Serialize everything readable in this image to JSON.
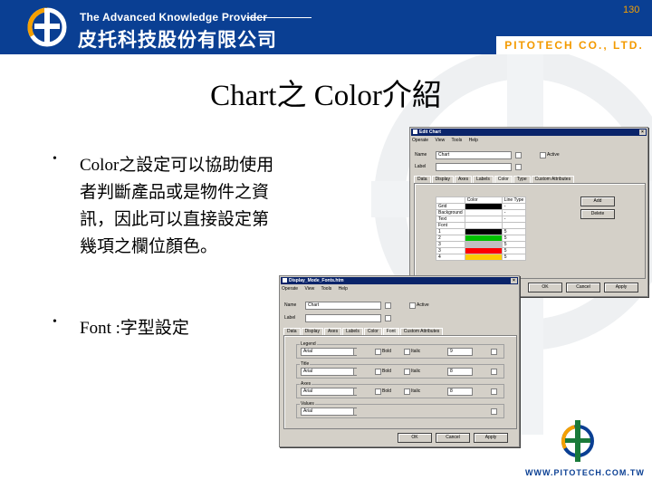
{
  "header": {
    "tagline": "The Advanced Knowledge Provider",
    "company_cn": "皮托科技股份有限公司",
    "company_en": "PITOTECH CO., LTD.",
    "page_number": "130"
  },
  "slide": {
    "title": "Chart之 Color介紹",
    "bullets": [
      "Color之設定可以協助使用者判斷產品或是物件之資訊，因此可以直接設定第幾項之欄位顏色。",
      "Font :字型設定"
    ]
  },
  "dialog_color": {
    "title": "Edit Chart",
    "menu": [
      "Operate",
      "View",
      "Tools",
      "Help"
    ],
    "name_label": "Name",
    "name_value": "Chart",
    "label_label": "Label",
    "label_value": "",
    "active_label": "Active",
    "tabs": [
      "Data",
      "Display",
      "Axes",
      "Labels",
      "Color",
      "Type",
      "Custom Attributes"
    ],
    "grid_headers": [
      "",
      "Color",
      "Line Type"
    ],
    "grid_rows": [
      {
        "label": "Grid",
        "color": "#000000",
        "line": "-"
      },
      {
        "label": "Background",
        "color": "#ffffff",
        "line": "-"
      },
      {
        "label": "Text",
        "color": "#ffffff",
        "line": "-"
      },
      {
        "label": "Font",
        "color": "#ffffff",
        "line": ""
      },
      {
        "label": "1",
        "color": "#000000",
        "line": "5"
      },
      {
        "label": "2",
        "color": "#00c000",
        "line": "5"
      },
      {
        "label": "3",
        "color": "#c0c0c0",
        "line": "5"
      },
      {
        "label": "3",
        "color": "#ff0000",
        "line": "5"
      },
      {
        "label": "4",
        "color": "#ffcc00",
        "line": "5"
      }
    ],
    "add_button": "Add",
    "delete_button": "Delete",
    "ok_button": "OK",
    "cancel_button": "Cancel",
    "apply_button": "Apply"
  },
  "dialog_font": {
    "title": "Display_Mode_Fonts.htm",
    "menu": [
      "Operate",
      "View",
      "Tools",
      "Help"
    ],
    "name_label": "Name",
    "name_value": "Chart",
    "label_label": "Label",
    "label_value": "",
    "active_label": "Active",
    "tabs": [
      "Data",
      "Display",
      "Axes",
      "Labels",
      "Color",
      "Font",
      "Custom Attributes"
    ],
    "groups": [
      {
        "label": "Legend",
        "font": "Arial",
        "bold": "Bold",
        "italic": "Italic",
        "size": "9"
      },
      {
        "label": "Title",
        "font": "Arial",
        "bold": "Bold",
        "italic": "Italic",
        "size": "8"
      },
      {
        "label": "Axes",
        "font": "Arial",
        "bold": "Bold",
        "italic": "Italic",
        "size": "8"
      },
      {
        "label": "Values",
        "font": "Arial",
        "bold": "",
        "italic": "",
        "size": ""
      }
    ],
    "ok_button": "OK",
    "cancel_button": "Cancel",
    "apply_button": "Apply"
  },
  "footer": {
    "website": "WWW.PITOTECH.COM.TW"
  },
  "colors": {
    "brand_blue": "#0a3f93",
    "brand_orange": "#f39a00",
    "watermark": "#eef0f2"
  }
}
